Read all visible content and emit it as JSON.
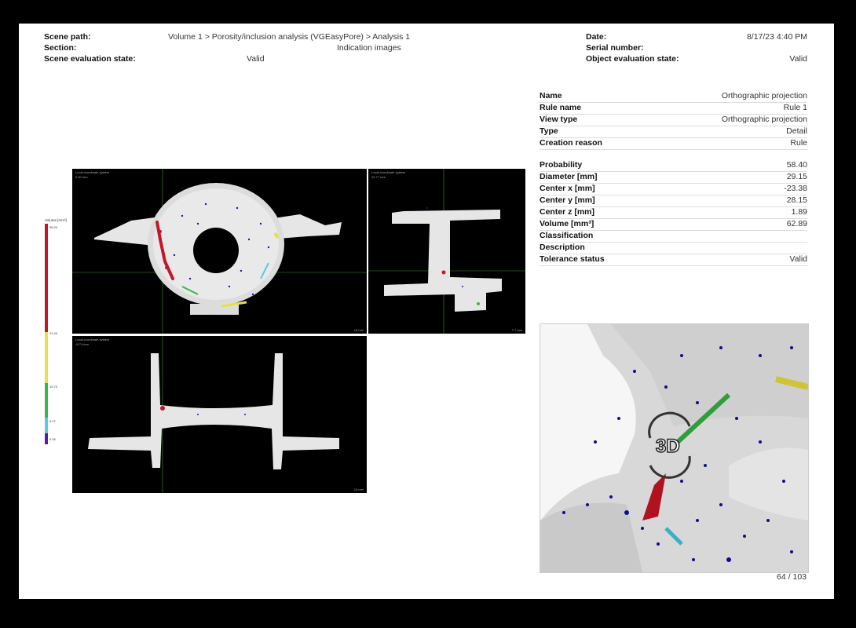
{
  "header": {
    "scene_path_label": "Scene path:",
    "scene_path_value": "Volume 1 > Porosity/inclusion analysis (VGEasyPore) > Analysis 1",
    "section_label": "Section:",
    "section_value": "Indication images",
    "scene_eval_label": "Scene evaluation state:",
    "scene_eval_value": "Valid",
    "date_label": "Date:",
    "date_value": "8/17/23 4:40 PM",
    "serial_label": "Serial number:",
    "serial_value": "",
    "object_eval_label": "Object evaluation state:",
    "object_eval_value": "Valid"
  },
  "properties": [
    {
      "key": "Name",
      "value": "Orthographic projection"
    },
    {
      "key": "Rule name",
      "value": "Rule 1"
    },
    {
      "key": "View type",
      "value": "Orthographic projection"
    },
    {
      "key": "Type",
      "value": "Detail"
    },
    {
      "key": "Creation reason",
      "value": "Rule"
    }
  ],
  "measurements": [
    {
      "key": "Probability",
      "value": "58.40"
    },
    {
      "key": "Diameter [mm]",
      "value": "29.15"
    },
    {
      "key": "Center x [mm]",
      "value": "-23.38"
    },
    {
      "key": "Center y [mm]",
      "value": "28.15"
    },
    {
      "key": "Center z [mm]",
      "value": "1.89"
    },
    {
      "key": "Volume [mm³]",
      "value": "62.89"
    },
    {
      "key": "Classification",
      "value": ""
    },
    {
      "key": "Description",
      "value": ""
    },
    {
      "key": "Tolerance status",
      "value": "Valid"
    }
  ],
  "legend": {
    "title": "Volume [mm³]",
    "ticks": [
      "55.00",
      "21.40",
      "10.70",
      "5.37",
      "0.05"
    ],
    "colors": [
      "#c0182a",
      "#e8e04a",
      "#39b54a",
      "#5ec8e8",
      "#5a1ea0"
    ]
  },
  "views": {
    "top": {
      "title": "Local coordinate system",
      "coord": "0.00 mm",
      "scale": "10 mm"
    },
    "side": {
      "title": "Local coordinate system",
      "coord": "22.77 mm",
      "scale": "7.7 mm"
    },
    "front": {
      "title": "Local coordinate system",
      "coord": "-8.74 mm",
      "scale": "10 mm"
    },
    "render_3d_badge": "3D"
  },
  "footer": {
    "page_number": "64 / 103"
  },
  "colors": {
    "porosity_small": "#1a1aa8",
    "porosity_mid": "#39b54a",
    "porosity_large": "#c0182a"
  }
}
